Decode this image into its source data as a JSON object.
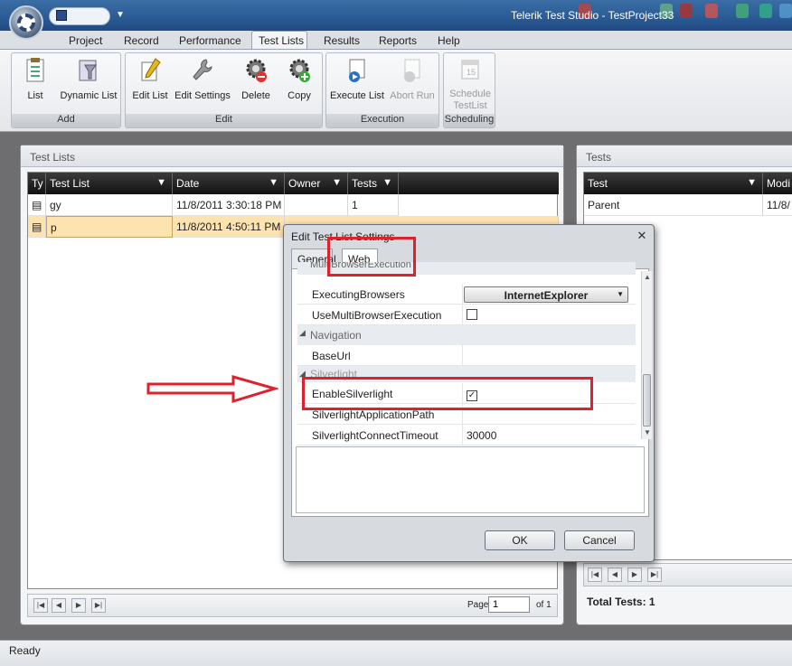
{
  "window": {
    "title": "Telerik Test Studio - TestProject33"
  },
  "ribbon": {
    "tabs": [
      "Project",
      "Record",
      "Performance",
      "Test Lists",
      "Results",
      "Reports",
      "Help"
    ],
    "active_tab": "Test Lists",
    "groups": [
      {
        "label": "Add",
        "buttons": [
          {
            "label": "List",
            "icon": "list-icon"
          },
          {
            "label": "Dynamic List",
            "icon": "dynamic-list-icon"
          }
        ]
      },
      {
        "label": "Edit",
        "buttons": [
          {
            "label": "Edit List",
            "icon": "pencil-icon"
          },
          {
            "label": "Edit Settings",
            "icon": "wrench-icon"
          },
          {
            "label": "Delete",
            "icon": "delete-gear-icon"
          },
          {
            "label": "Copy",
            "icon": "copy-gear-icon"
          }
        ]
      },
      {
        "label": "Execution",
        "buttons": [
          {
            "label": "Execute List",
            "icon": "execute-icon"
          },
          {
            "label": "Abort Run",
            "icon": "abort-icon"
          }
        ]
      },
      {
        "label": "Scheduling",
        "buttons": [
          {
            "label": "Schedule TestList",
            "icon": "calendar-icon"
          }
        ]
      }
    ]
  },
  "test_lists_panel": {
    "title": "Test Lists",
    "columns": [
      "Ty",
      "Test List",
      "Date",
      "Owner",
      "Tests"
    ],
    "rows": [
      {
        "name": "gy",
        "date": "11/8/2011 3:30:18 PM",
        "owner": "",
        "tests": "1"
      },
      {
        "name": "p",
        "date": "11/8/2011 4:50:11 PM",
        "owner": "",
        "tests": ""
      }
    ],
    "pager": {
      "page_label": "Page",
      "page_value": "1",
      "of_label": "of 1"
    }
  },
  "tests_panel": {
    "title": "Tests",
    "columns": [
      "Test",
      "Modi"
    ],
    "rows": [
      {
        "test": "Parent",
        "modified": "11/8/"
      }
    ],
    "total": "Total Tests: 1"
  },
  "status": {
    "text": "Ready"
  },
  "dialog": {
    "title": "Edit Test List Settings",
    "tabs": [
      "General",
      "Web"
    ],
    "active_tab": "Web",
    "partial_category": "MultiBrowserExecution",
    "properties": [
      {
        "name": "ExecutingBrowsers",
        "value": "InternetExplorer"
      },
      {
        "name": "UseMultiBrowserExecution",
        "value": ""
      }
    ],
    "category_navigation": "Navigation",
    "nav_properties": [
      {
        "name": "BaseUrl",
        "value": ""
      }
    ],
    "category_silverlight": "Silverlight",
    "sl_properties": [
      {
        "name": "EnableSilverlight",
        "value": "✓"
      },
      {
        "name": "SilverlightApplicationPath",
        "value": ""
      },
      {
        "name": "SilverlightConnectTimeout",
        "value": "30000"
      }
    ],
    "ok_label": "OK",
    "cancel_label": "Cancel"
  }
}
